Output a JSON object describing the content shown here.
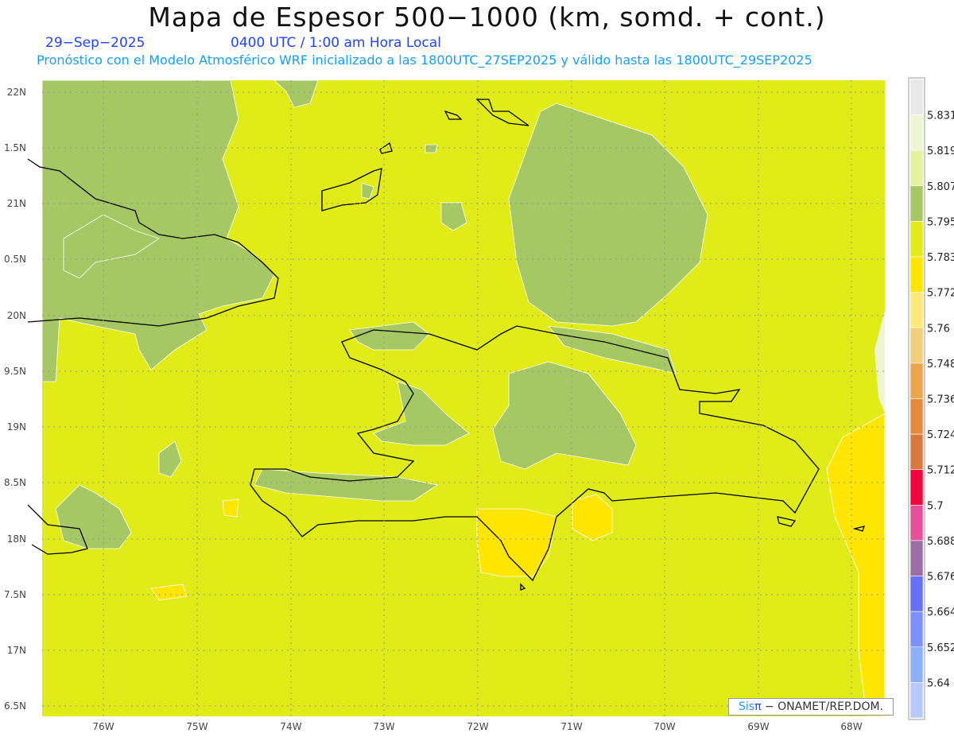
{
  "header": {
    "title": "Mapa de Espesor 500−1000 (km, somd. + cont.)",
    "date": "29−Sep−2025",
    "time": "0400 UTC / 1:00 am Hora Local",
    "subtitle": "Pronóstico con el Modelo Atmosférico WRF inicializado a las 1800UTC_27SEP2025 y válido hasta las  1800UTC_29SEP2025"
  },
  "axes": {
    "lon_labels": [
      "76W",
      "75W",
      "74W",
      "73W",
      "72W",
      "71W",
      "70W",
      "69W",
      "68W"
    ],
    "lat_labels": [
      "22N",
      "1.5N",
      "21N",
      "0.5N",
      "20N",
      "9.5N",
      "19N",
      "8.5N",
      "18N",
      "7.5N",
      "17N",
      "6.5N"
    ]
  },
  "colorbar": {
    "labels": [
      "5.831",
      "5.819",
      "5.807",
      "5.795",
      "5.783",
      "5.772",
      "5.76",
      "5.748",
      "5.736",
      "5.724",
      "5.712",
      "5.7",
      "5.688",
      "5.676",
      "5.664",
      "5.652",
      "5.64"
    ],
    "colors": [
      "#e8e8e8",
      "#eef5d4",
      "#e5f2a0",
      "#a5c864",
      "#e0eb18",
      "#ffe600",
      "#ffe97a",
      "#f2cd7a",
      "#eba54a",
      "#e48c3c",
      "#d8783c",
      "#f0053c",
      "#e6509b",
      "#9b6ea5",
      "#6470f5",
      "#7d91fa",
      "#8caffa",
      "#b9c8fa"
    ]
  },
  "colors": {
    "background": "#e0eb18",
    "lowland": "#a5c864",
    "warm": "#ffe600",
    "coast": "#000000"
  },
  "credit": {
    "sis": "Sis",
    "pi": "π",
    "text": "− ONAMET/REP.DOM."
  }
}
